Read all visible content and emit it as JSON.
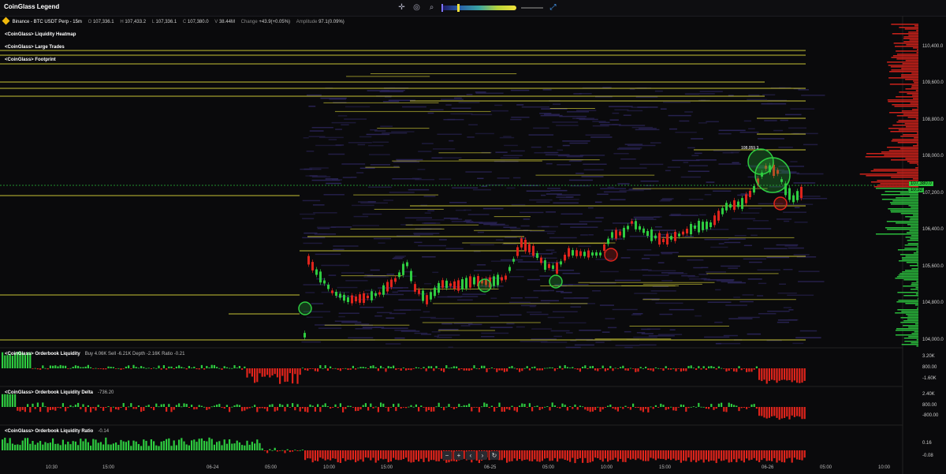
{
  "app": {
    "title": "CoinGlass Legend"
  },
  "toolbar": {
    "icons": [
      "crosshair-icon",
      "target-icon",
      "search-icon",
      "color-scale",
      "expand-icon"
    ]
  },
  "symbol": {
    "name": "Binance - BTC USDT Perp - 15m",
    "open_label": "O",
    "open": "107,336.1",
    "high_label": "H",
    "high": "107,433.2",
    "low_label": "L",
    "low": "107,336.1",
    "close_label": "C",
    "close": "107,380.0",
    "vol_label": "V",
    "volume": "38.44M",
    "change_label": "Change",
    "change": "+43.9(+0.05%)",
    "amp_label": "Amplitude",
    "amplitude": "97.1(0.09%)"
  },
  "legends": [
    "<CoinGlass> Liquidity Heatmap",
    "<CoinGlass> Large Trades",
    "<CoinGlass> Footprint"
  ],
  "price_axis": [
    "110,400.0",
    "109,600.0",
    "108,800.0",
    "108,000.0",
    "107,200.0",
    "106,400.0",
    "105,600.0",
    "104,800.0",
    "104,000.0"
  ],
  "current_price": {
    "price": "107,380.0",
    "countdown": "10:32"
  },
  "marker": {
    "label": "108,059.3"
  },
  "indicators": [
    {
      "title": "<CoinGlass> Orderbook Liquidity",
      "stats": "Buy 4.06K  Sell -6.21K  Depth -2.16K  Ratio -0.21",
      "axis": [
        "3.20K",
        "800.00",
        "-1.60K"
      ]
    },
    {
      "title": "<CoinGlass> Orderbook Liquidity Delta",
      "stats": "-736.20",
      "axis": [
        "2.40K",
        "800.00",
        "-800.00"
      ]
    },
    {
      "title": "<CoinGlass> Orderbook Liquidity Ratio",
      "stats": "-0.14",
      "axis": [
        "0.16",
        "-0.08"
      ]
    }
  ],
  "time_axis": [
    "10:30",
    "15:00",
    "06-24",
    "05:00",
    "10:00",
    "15:00",
    "06-25",
    "05:00",
    "10:00",
    "15:00",
    "06-26",
    "05:00",
    "10:00"
  ],
  "nav": {
    "zoom_out": "−",
    "zoom_in": "+",
    "prev": "‹",
    "next": "›",
    "reset": "↻"
  },
  "colors": {
    "up": "#2ecc40",
    "down": "#e0241c",
    "level": "#e6e13a",
    "heat": "#2a2456"
  }
}
